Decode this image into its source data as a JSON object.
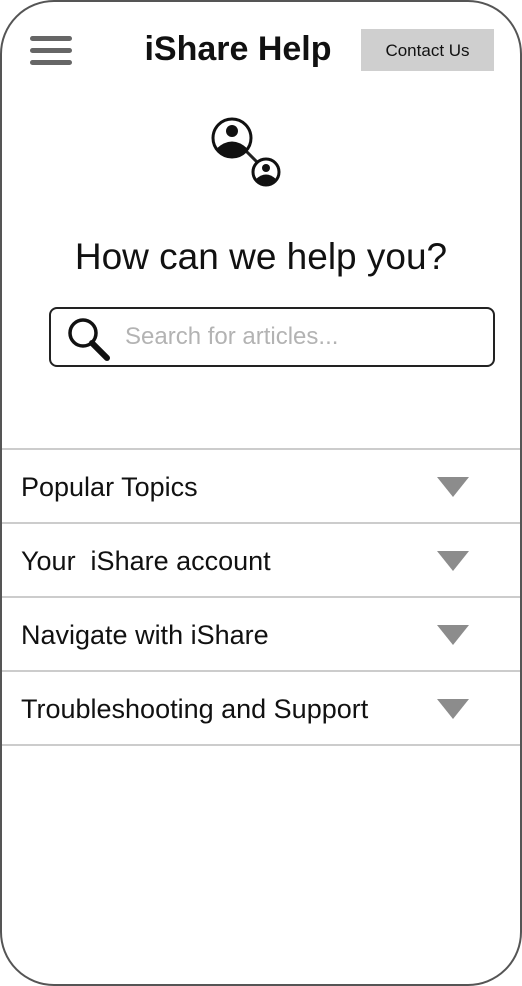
{
  "header": {
    "menu_icon": "hamburger-menu-icon",
    "title": "iShare Help",
    "contact_label": "Contact Us"
  },
  "logo": {
    "icon": "people-connection-icon"
  },
  "hero": {
    "heading": "How can we help you?"
  },
  "search": {
    "icon": "search-icon",
    "placeholder": "Search for articles...",
    "value": ""
  },
  "topics": [
    {
      "label": "Popular Topics",
      "icon": "triangle-down-icon"
    },
    {
      "label": "Your  iShare account",
      "icon": "triangle-down-icon"
    },
    {
      "label": "Navigate with iShare",
      "icon": "triangle-down-icon"
    },
    {
      "label": "Troubleshooting and Support",
      "icon": "triangle-down-icon"
    }
  ],
  "colors": {
    "button_bg": "#cfcfcf",
    "arrow": "#8c8c8c",
    "divider": "#cccccc",
    "text": "#111111"
  }
}
